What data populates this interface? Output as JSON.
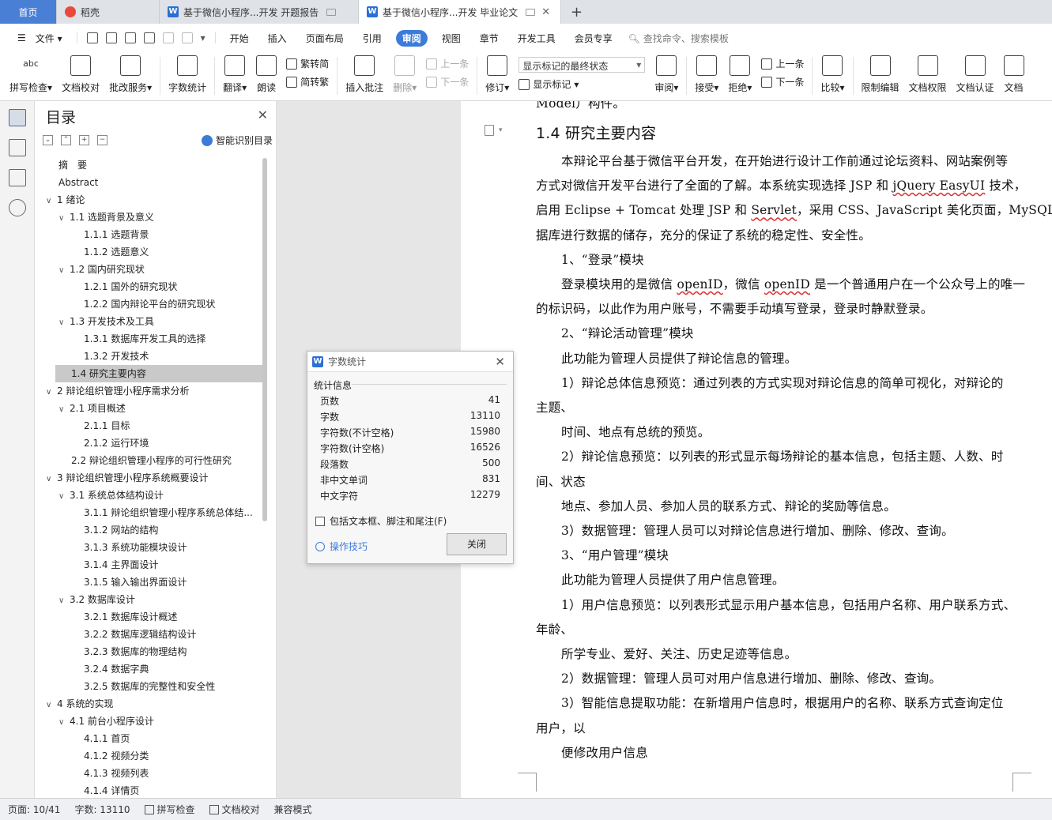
{
  "tabs": [
    {
      "label": "首页",
      "type": "home"
    },
    {
      "label": "稻壳",
      "type": "docer"
    },
    {
      "label": "基于微信小程序...开发 开题报告",
      "type": "doc"
    },
    {
      "label": "基于微信小程序...开发 毕业论文",
      "type": "doc-active"
    }
  ],
  "menu": {
    "file": "文件",
    "items": [
      "开始",
      "插入",
      "页面布局",
      "引用",
      "审阅",
      "视图",
      "章节",
      "开发工具",
      "会员专享"
    ],
    "selected": "审阅",
    "search": "查找命令、搜索模板"
  },
  "ribbon": {
    "spell": "拼写检查",
    "proof": "文档校对",
    "correct": "批改服务",
    "wordcount": "字数统计",
    "translate": "翻译",
    "read": "朗读",
    "t2s": "繁转简",
    "s2t": "简转繁",
    "insert_comment": "插入批注",
    "delete": "删除",
    "prev_comment": "上一条",
    "next_comment": "下一条",
    "revise": "修订",
    "markup_select": "显示标记的最终状态",
    "show_markup": "显示标记",
    "review": "审阅",
    "accept": "接受",
    "reject": "拒绝",
    "prev": "上一条",
    "next": "下一条",
    "compare": "比较",
    "restrict": "限制编辑",
    "permission": "文档权限",
    "certify": "文档认证",
    "more": "文档"
  },
  "toc": {
    "title": "目录",
    "smart": "智能识别目录",
    "items": [
      {
        "t": "摘　要",
        "lv": 0,
        "ar": ""
      },
      {
        "t": "Abstract",
        "lv": 0,
        "ar": ""
      },
      {
        "t": "1  绪论",
        "lv": 0,
        "ar": "v"
      },
      {
        "t": "1.1 选题背景及意义",
        "lv": 1,
        "ar": "v"
      },
      {
        "t": "1.1.1 选题背景",
        "lv": 2,
        "ar": ""
      },
      {
        "t": "1.1.2 选题意义",
        "lv": 2,
        "ar": ""
      },
      {
        "t": "1.2 国内研究现状",
        "lv": 1,
        "ar": "v"
      },
      {
        "t": "1.2.1 国外的研究现状",
        "lv": 2,
        "ar": ""
      },
      {
        "t": "1.2.2 国内辩论平台的研究现状",
        "lv": 2,
        "ar": ""
      },
      {
        "t": "1.3 开发技术及工具",
        "lv": 1,
        "ar": "v"
      },
      {
        "t": "1.3.1 数据库开发工具的选择",
        "lv": 2,
        "ar": ""
      },
      {
        "t": "1.3.2  开发技术",
        "lv": 2,
        "ar": ""
      },
      {
        "t": "1.4 研究主要内容",
        "lv": 1,
        "ar": "",
        "sel": true
      },
      {
        "t": "2  辩论组织管理小程序需求分析",
        "lv": 0,
        "ar": "v"
      },
      {
        "t": "2.1  项目概述",
        "lv": 1,
        "ar": "v"
      },
      {
        "t": "2.1.1 目标",
        "lv": 2,
        "ar": ""
      },
      {
        "t": "2.1.2 运行环境",
        "lv": 2,
        "ar": ""
      },
      {
        "t": "2.2 辩论组织管理小程序的可行性研究",
        "lv": 1,
        "ar": ""
      },
      {
        "t": "3  辩论组织管理小程序系统概要设计",
        "lv": 0,
        "ar": "v"
      },
      {
        "t": "3.1  系统总体结构设计",
        "lv": 1,
        "ar": "v"
      },
      {
        "t": "3.1.1 辩论组织管理小程序系统总体结...",
        "lv": 2,
        "ar": ""
      },
      {
        "t": "3.1.2 网站的结构",
        "lv": 2,
        "ar": ""
      },
      {
        "t": "3.1.3 系统功能模块设计",
        "lv": 2,
        "ar": ""
      },
      {
        "t": "3.1.4 主界面设计",
        "lv": 2,
        "ar": ""
      },
      {
        "t": "3.1.5 输入输出界面设计",
        "lv": 2,
        "ar": ""
      },
      {
        "t": "3.2  数据库设计",
        "lv": 1,
        "ar": "v"
      },
      {
        "t": "3.2.1 数据库设计概述",
        "lv": 2,
        "ar": ""
      },
      {
        "t": "3.2.2 数据库逻辑结构设计",
        "lv": 2,
        "ar": ""
      },
      {
        "t": "3.2.3 数据库的物理结构",
        "lv": 2,
        "ar": ""
      },
      {
        "t": "3.2.4 数据字典",
        "lv": 2,
        "ar": ""
      },
      {
        "t": "3.2.5 数据库的完整性和安全性",
        "lv": 2,
        "ar": ""
      },
      {
        "t": "4  系统的实现",
        "lv": 0,
        "ar": "v"
      },
      {
        "t": "4.1 前台小程序设计",
        "lv": 1,
        "ar": "v"
      },
      {
        "t": "4.1.1 首页",
        "lv": 2,
        "ar": ""
      },
      {
        "t": "4.1.2 视频分类",
        "lv": 2,
        "ar": ""
      },
      {
        "t": "4.1.3 视频列表",
        "lv": 2,
        "ar": ""
      },
      {
        "t": "4.1.4 详情页",
        "lv": 2,
        "ar": ""
      }
    ]
  },
  "document": {
    "top_cut": "Model）构件。",
    "heading": "1.4 研究主要内容",
    "lines": [
      {
        "t": "本辩论平台基于微信平台开发，在开始进行设计工作前通过论坛资料、网站案例等",
        "ind": true
      },
      {
        "t": "方式对微信开发平台进行了全面的了解。本系统实现选择 JSP 和 jQuery EasyUI 技术，",
        "ind": false
      },
      {
        "t": "启用 Eclipse + Tomcat 处理 JSP 和 Servlet，采用 CSS、JavaScript 美化页面，MySQL 数",
        "ind": false
      },
      {
        "t": "据库进行数据的储存，充分的保证了系统的稳定性、安全性。",
        "ind": false
      },
      {
        "t": "1、“登录”模块",
        "ind": true
      },
      {
        "t": "登录模块用的是微信 openID，微信 openID 是一个普通用户在一个公众号上的唯一",
        "ind": true
      },
      {
        "t": "的标识码，以此作为用户账号，不需要手动填写登录，登录时静默登录。",
        "ind": false
      },
      {
        "t": "2、“辩论活动管理”模块",
        "ind": true
      },
      {
        "t": "此功能为管理人员提供了辩论信息的管理。",
        "ind": true
      },
      {
        "t": "1）辩论总体信息预览：通过列表的方式实现对辩论信息的简单可视化，对辩论的",
        "ind": true
      },
      {
        "t": "主题、",
        "ind": false
      },
      {
        "t": "时间、地点有总统的预览。",
        "ind": true
      },
      {
        "t": "2）辩论信息预览：以列表的形式显示每场辩论的基本信息，包括主题、人数、时",
        "ind": true
      },
      {
        "t": "间、状态",
        "ind": false
      },
      {
        "t": "地点、参加人员、参加人员的联系方式、辩论的奖励等信息。",
        "ind": true
      },
      {
        "t": "3）数据管理：管理人员可以对辩论信息进行增加、删除、修改、查询。",
        "ind": true
      },
      {
        "t": "3、“用户管理”模块",
        "ind": true
      },
      {
        "t": "此功能为管理人员提供了用户信息管理。",
        "ind": true
      },
      {
        "t": "1）用户信息预览：以列表形式显示用户基本信息，包括用户名称、用户联系方式、",
        "ind": true
      },
      {
        "t": "年龄、",
        "ind": false
      },
      {
        "t": "所学专业、爱好、关注、历史足迹等信息。",
        "ind": true
      },
      {
        "t": "2）数据管理：管理人员可对用户信息进行增加、删除、修改、查询。",
        "ind": true
      },
      {
        "t": "3）智能信息提取功能：在新增用户信息时，根据用户的名称、联系方式查询定位",
        "ind": true
      },
      {
        "t": "用户，以",
        "ind": false
      },
      {
        "t": "便修改用户信息",
        "ind": true
      }
    ]
  },
  "dialog": {
    "title": "字数统计",
    "group": "统计信息",
    "rows": [
      {
        "k": "页数",
        "v": "41"
      },
      {
        "k": "字数",
        "v": "13110"
      },
      {
        "k": "字符数(不计空格)",
        "v": "15980"
      },
      {
        "k": "字符数(计空格)",
        "v": "16526"
      },
      {
        "k": "段落数",
        "v": "500"
      },
      {
        "k": "非中文单词",
        "v": "831"
      },
      {
        "k": "中文字符",
        "v": "12279"
      }
    ],
    "checkbox": "包括文本框、脚注和尾注(F)",
    "tips": "操作技巧",
    "close": "关闭"
  },
  "status": {
    "page": "页面: 10/41",
    "words": "字数: 13110",
    "spell": "拼写检查",
    "proof": "文档校对",
    "compat": "兼容模式"
  }
}
